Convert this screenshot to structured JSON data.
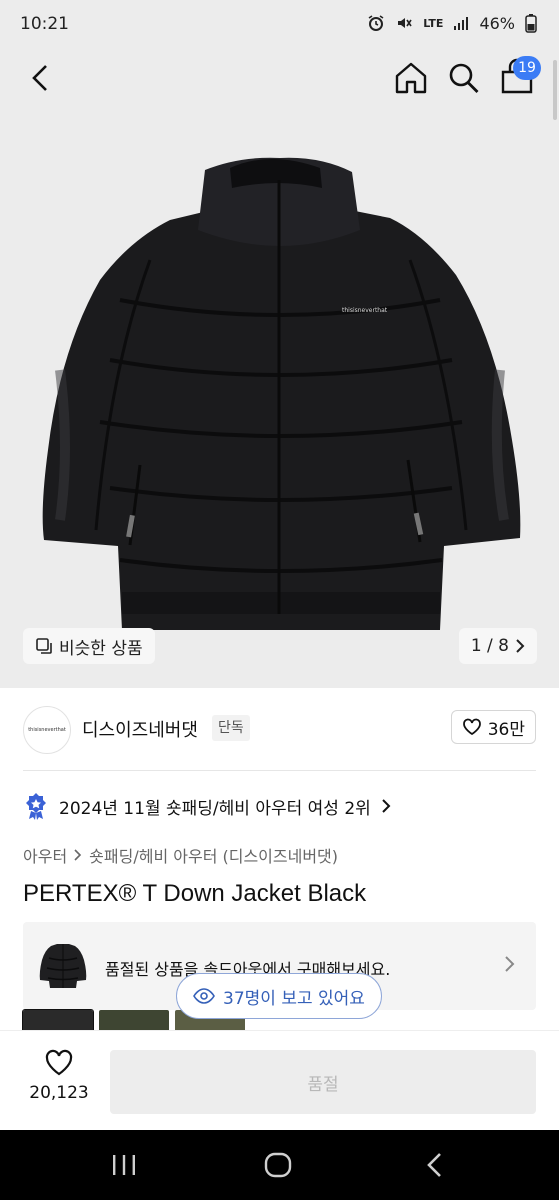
{
  "status_bar": {
    "time": "10:21",
    "network": "LTE",
    "battery": "46%",
    "icons": [
      "alarm-icon",
      "mute-icon",
      "signal-icon",
      "battery-icon"
    ]
  },
  "nav": {
    "cart_count": "19",
    "accent_color": "#3b7cf5"
  },
  "gallery": {
    "similar_label": "비슷한 상품",
    "page_indicator": "1 / 8",
    "jacket_logo_text": "thisisneverthat"
  },
  "brand": {
    "name": "디스이즈네버댓",
    "tag": "단독",
    "likes": "36만",
    "logo_text": "thisisneverthat"
  },
  "ranking": {
    "text": "2024년 11월 숏패딩/헤비 아우터 여성 2위"
  },
  "breadcrumb": {
    "category": "아우터",
    "subcategory": "숏패딩/헤비 아우터 (디스이즈네버댓)"
  },
  "product": {
    "title": "PERTEX® T Down Jacket Black"
  },
  "soldout_banner": {
    "text": "품절된 상품을 솔드아웃에서 구매해보세요."
  },
  "viewers": {
    "text": "37명이 보고 있어요"
  },
  "swatches": [
    {
      "color": "#2a2a2a"
    },
    {
      "color": "#3e4532"
    },
    {
      "color": "#5b5e44"
    }
  ],
  "action_bar": {
    "wish_count": "20,123",
    "main_button": "품절"
  }
}
